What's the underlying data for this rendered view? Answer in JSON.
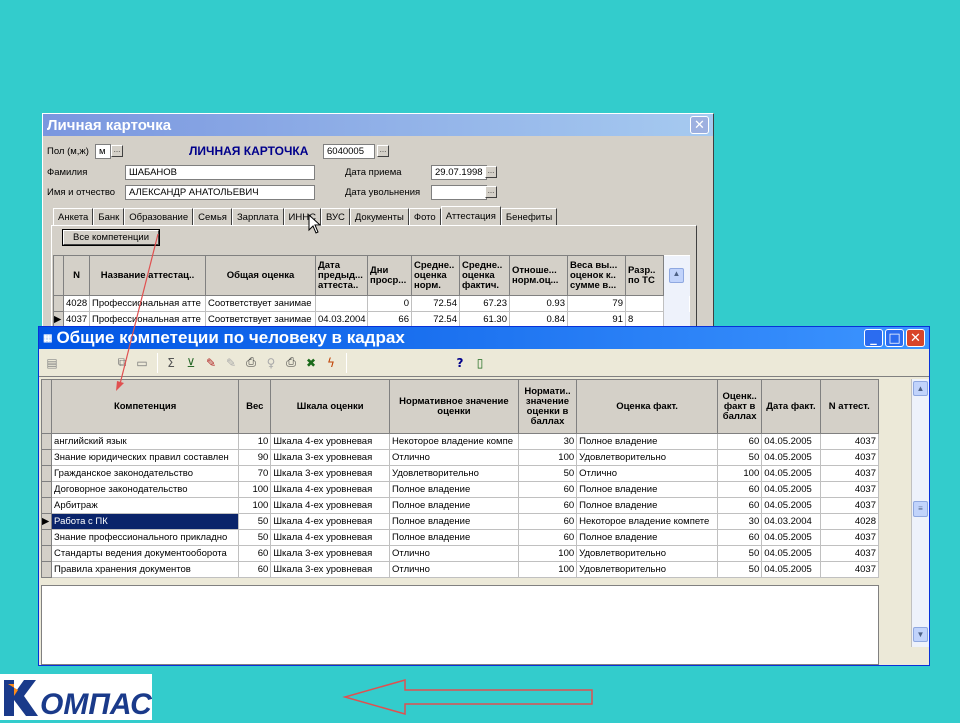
{
  "card": {
    "title": "Личная карточка",
    "gender_label": "Пол (м,ж)",
    "gender_value": "м",
    "heading": "ЛИЧНАЯ КАРТОЧКА",
    "card_number": "6040005",
    "surname_label": "Фамилия",
    "surname": "ШАБАНОВ",
    "name_label": "Имя и отчество",
    "name": "АЛЕКСАНДР АНАТОЛЬЕВИЧ",
    "hire_label": "Дата приема",
    "hire_date": "29.07.1998",
    "fire_label": "Дата увольнения",
    "fire_date": "",
    "tabs": [
      "Анкета",
      "Банк",
      "Образование",
      "Семья",
      "Зарплата",
      "ИННС",
      "ВУС",
      "Документы",
      "Фото",
      "Аттестация",
      "Бенефиты"
    ],
    "all_comp_button": "Все компетенции",
    "columns": [
      "N",
      "Название аттестац..",
      "Общая оценка",
      "Дата предыд... аттеста..",
      "Дни проср...",
      "Средне.. оценка норм.",
      "Средне.. оценка фактич.",
      "Отноше... норм.оц...",
      "Веса вы... оценок к.. сумме в...",
      "Разр.. по ТС"
    ],
    "rows": [
      [
        "4028",
        "Профессиональная атте",
        "Соответствует занимае",
        "",
        "0",
        "72.54",
        "67.23",
        "0.93",
        "79",
        ""
      ],
      [
        "4037",
        "Профессиональная атте",
        "Соответствует занимае",
        "04.03.2004",
        "66",
        "72.54",
        "61.30",
        "0.84",
        "91",
        "8"
      ]
    ]
  },
  "comp": {
    "title": "Общие компетеции по человеку в кадрах",
    "toolbar_icons": [
      "grid-icon",
      "copy-icon",
      "paste-icon",
      "sum-icon",
      "filter-icon",
      "pen-icon",
      "pen-disabled-icon",
      "preview-icon",
      "bulb-icon",
      "print-icon",
      "excel-icon",
      "lightning-icon",
      "help-icon",
      "exit-icon"
    ],
    "columns": [
      "Компетенция",
      "Вес",
      "Шкала оценки",
      "Нормативное значение оценки",
      "Нормати.. значение оценки в баллах",
      "Оценка факт.",
      "Оценк.. факт в баллах",
      "Дата факт.",
      "N аттест."
    ],
    "rows": [
      [
        "английский язык",
        "10",
        "Шкала 4-ех уровневая",
        "Некоторое владение компе",
        "30",
        "Полное владение",
        "60",
        "04.05.2005",
        "4037"
      ],
      [
        "Знание юридических правил составлен",
        "90",
        "Шкала 3-ех уровневая",
        "Отлично",
        "100",
        "Удовлетворительно",
        "50",
        "04.05.2005",
        "4037"
      ],
      [
        "Гражданское законодательство",
        "70",
        "Шкала 3-ех уровневая",
        "Удовлетворительно",
        "50",
        "Отлично",
        "100",
        "04.05.2005",
        "4037"
      ],
      [
        "Договорное законодательство",
        "100",
        "Шкала 4-ех уровневая",
        "Полное владение",
        "60",
        "Полное владение",
        "60",
        "04.05.2005",
        "4037"
      ],
      [
        "Арбитраж",
        "100",
        "Шкала 4-ех уровневая",
        "Полное владение",
        "60",
        "Полное владение",
        "60",
        "04.05.2005",
        "4037"
      ],
      [
        "Работа с ПК",
        "50",
        "Шкала 4-ех уровневая",
        "Полное владение",
        "60",
        "Некоторое владение компете",
        "30",
        "04.03.2004",
        "4028"
      ],
      [
        "Знание профессионального прикладно",
        "50",
        "Шкала 4-ех уровневая",
        "Полное владение",
        "60",
        "Полное владение",
        "60",
        "04.05.2005",
        "4037"
      ],
      [
        "Стандарты ведения документооборота",
        "60",
        "Шкала 3-ех уровневая",
        "Отлично",
        "100",
        "Удовлетворительно",
        "50",
        "04.05.2005",
        "4037"
      ],
      [
        "Правила хранения документов",
        "60",
        "Шкала 3-ех уровневая",
        "Отлично",
        "100",
        "Удовлетворительно",
        "50",
        "04.05.2005",
        "4037"
      ]
    ],
    "selected_row": 5
  },
  "logo": "КОМПАС",
  "colors": {
    "background": "#33cccc",
    "selection": "#0a246a",
    "arrow": "#e05050"
  }
}
